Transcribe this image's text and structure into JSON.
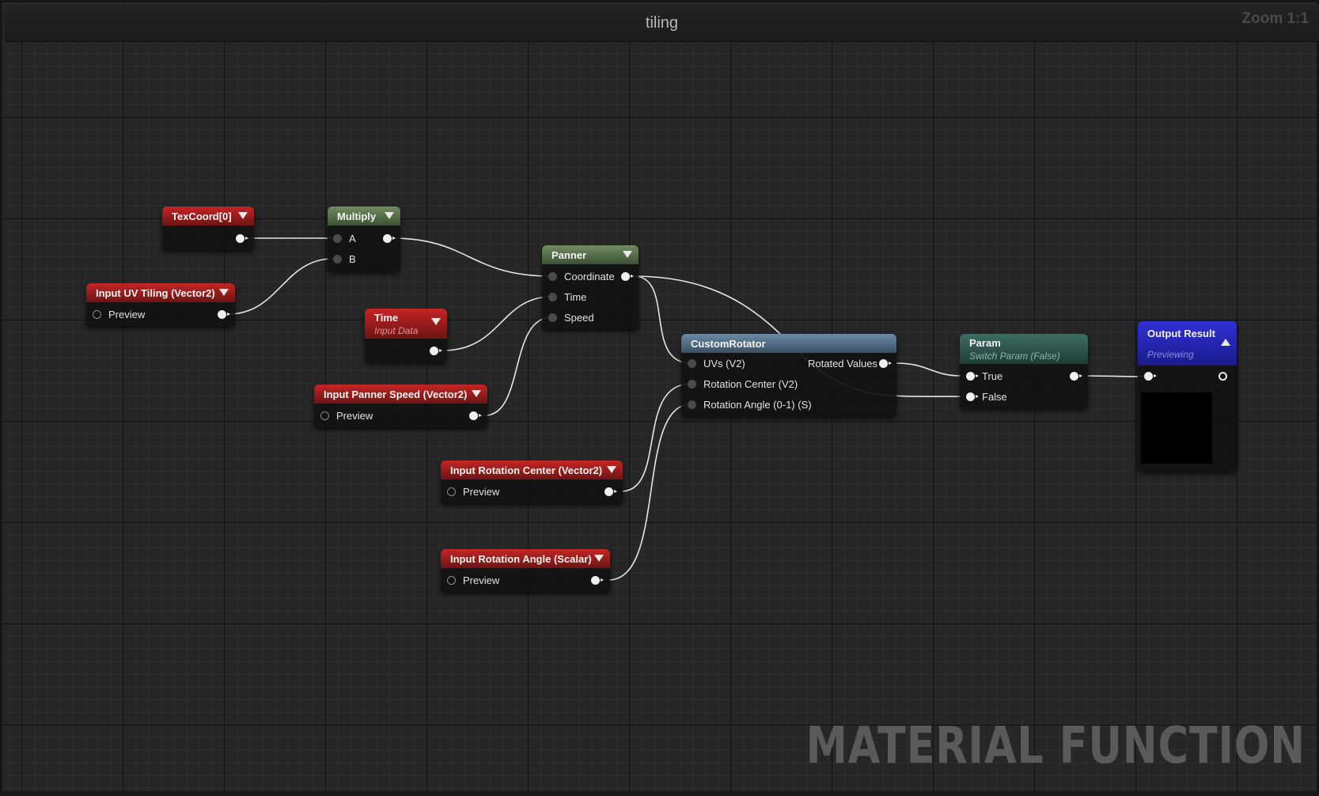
{
  "graph": {
    "title": "tiling",
    "zoom": "Zoom 1:1",
    "watermark": "MATERIAL FUNCTION"
  },
  "nodes": {
    "texcoord": {
      "title": "TexCoord[0]"
    },
    "multiply": {
      "title": "Multiply",
      "inputs": [
        "A",
        "B"
      ]
    },
    "input_uv_tiling": {
      "title": "Input UV Tiling (Vector2)",
      "preview": "Preview"
    },
    "time": {
      "title": "Time",
      "subtitle": "Input Data"
    },
    "panner": {
      "title": "Panner",
      "inputs": [
        "Coordinate",
        "Time",
        "Speed"
      ]
    },
    "input_panner_speed": {
      "title": "Input Panner Speed (Vector2)",
      "preview": "Preview"
    },
    "custom_rotator": {
      "title": "CustomRotator",
      "inputs": [
        "UVs (V2)",
        "Rotation Center (V2)",
        "Rotation Angle (0-1) (S)"
      ],
      "output": "Rotated Values"
    },
    "input_rotation_center": {
      "title": "Input Rotation Center (Vector2)",
      "preview": "Preview"
    },
    "input_rotation_angle": {
      "title": "Input Rotation Angle (Scalar)",
      "preview": "Preview"
    },
    "param": {
      "title": "Param",
      "subtitle": "Switch Param (False)",
      "inputs": [
        "True",
        "False"
      ]
    },
    "output_result": {
      "title": "Output Result",
      "subtitle": "Previewing"
    }
  },
  "colors": {
    "input_node": "#8e1a1a",
    "math_node": "#56704a",
    "function_node": "#4f6a82",
    "switch_node": "#2e5650",
    "output_node": "#2525b0",
    "wire": "#e6e6e6"
  },
  "icons": {
    "collapse": "chevron-down-icon",
    "expand": "chevron-up-icon",
    "pin": "pin-icon"
  }
}
